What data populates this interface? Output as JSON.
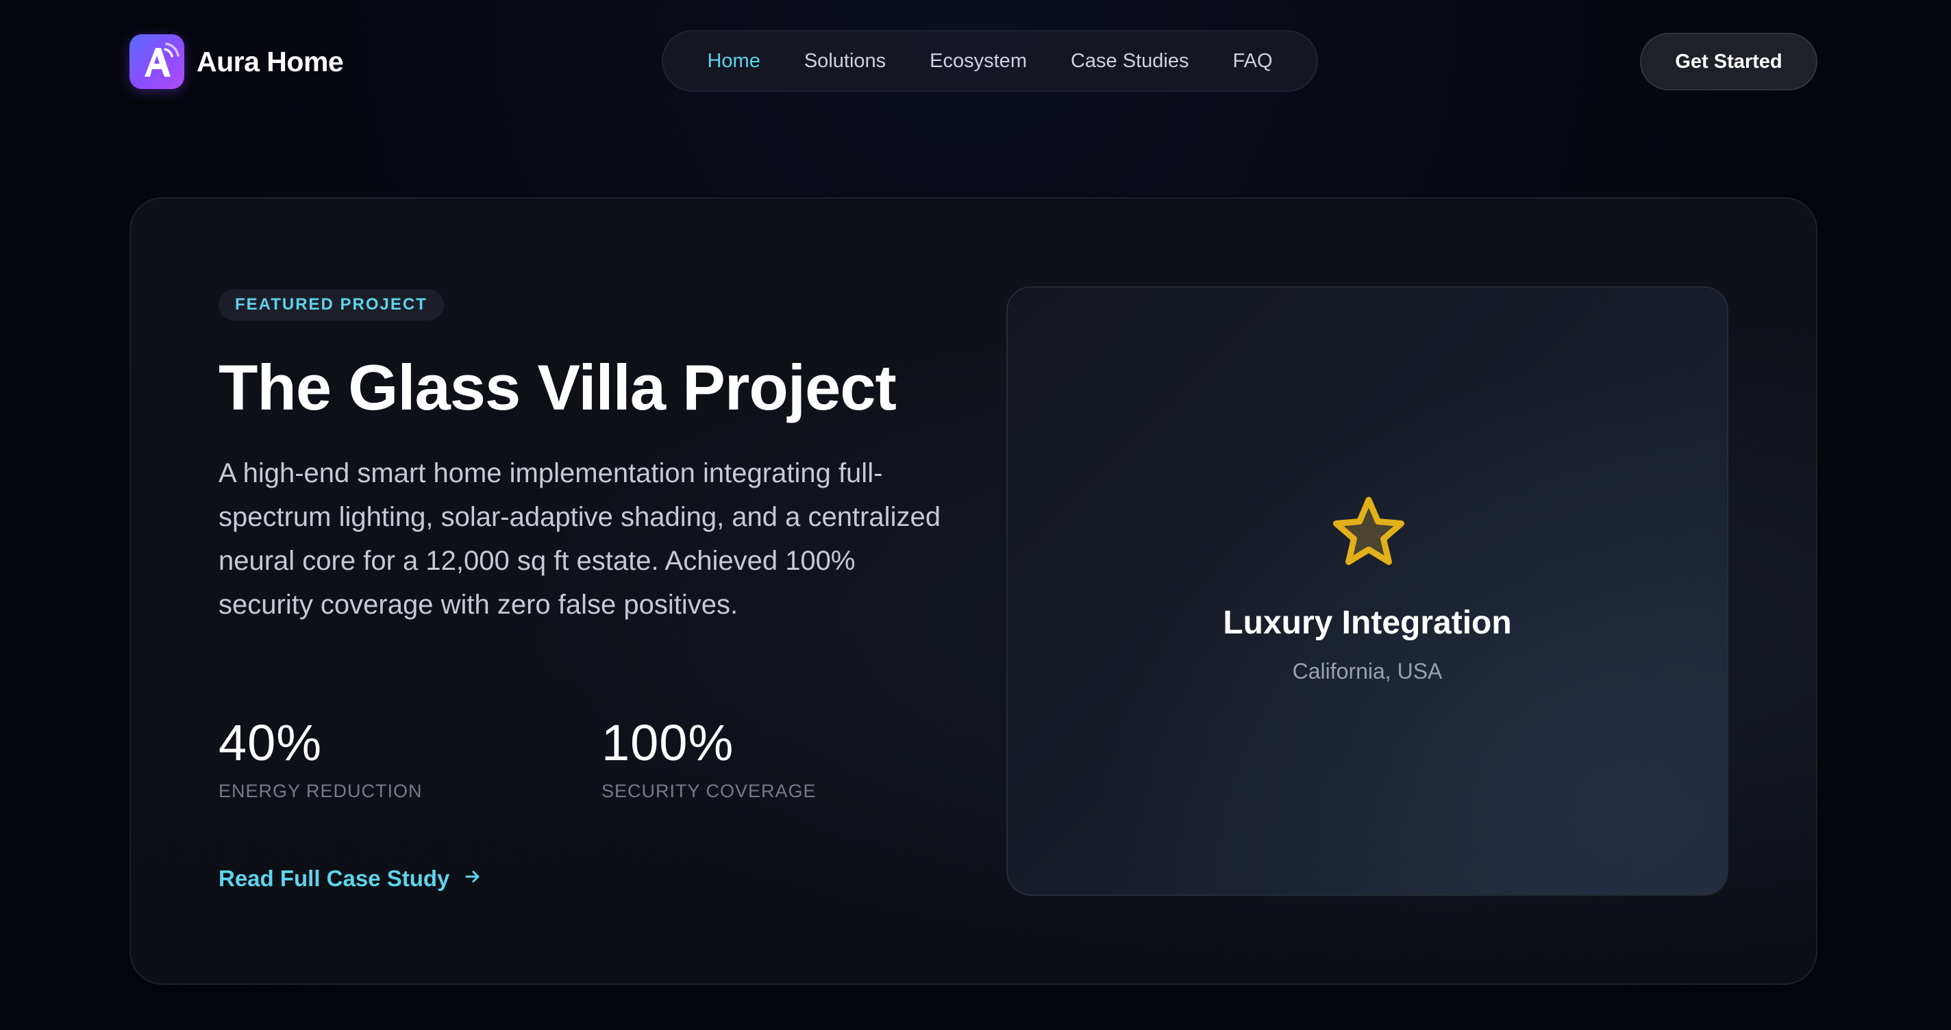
{
  "header": {
    "brand": {
      "name": "Aura Home",
      "logo_letter": "A",
      "logo_icon": "wifi-signal-icon"
    },
    "nav": {
      "items": [
        {
          "label": "Home",
          "active": true
        },
        {
          "label": "Solutions",
          "active": false
        },
        {
          "label": "Ecosystem",
          "active": false
        },
        {
          "label": "Case Studies",
          "active": false
        },
        {
          "label": "FAQ",
          "active": false
        }
      ]
    },
    "cta_label": "Get Started"
  },
  "feature": {
    "badge": "FEATURED PROJECT",
    "title": "The Glass Villa Project",
    "description": "A high-end smart home implementation integrating full-spectrum lighting, solar-adaptive shading, and a centralized neural core for a 12,000 sq ft estate. Achieved 100% security coverage with zero false positives.",
    "stats": [
      {
        "value": "40%",
        "label": "ENERGY REDUCTION"
      },
      {
        "value": "100%",
        "label": "SECURITY COVERAGE"
      }
    ],
    "link": {
      "label": "Read Full Case Study",
      "icon": "arrow-right-icon"
    },
    "visual": {
      "icon": "star-icon",
      "title": "Luxury Integration",
      "subtitle": "California, USA"
    }
  },
  "colors": {
    "background": "#05060d",
    "card": "#0f1119",
    "accent_cyan": "#5ed4ec",
    "star_gold": "#e2b019",
    "logo_gradient_start": "#5b6cff",
    "logo_gradient_end": "#b04cf0",
    "muted_text": "#767b89"
  }
}
